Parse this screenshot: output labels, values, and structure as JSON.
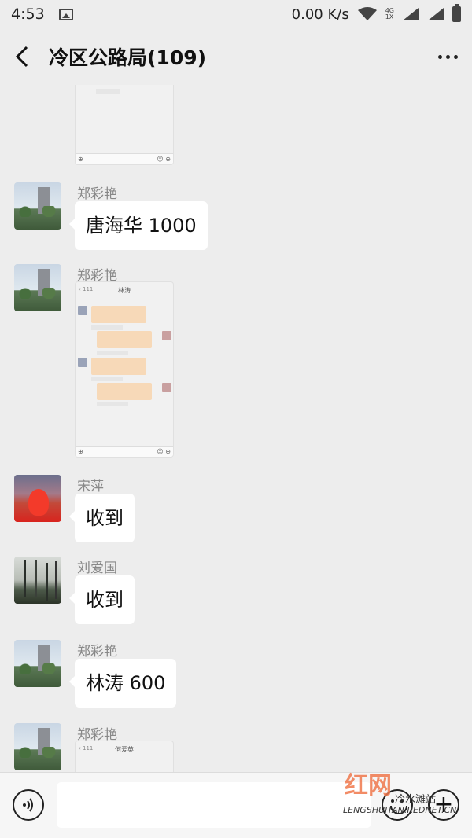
{
  "status_bar": {
    "time": "4:53",
    "network_speed": "0.00 K/s",
    "net_label_top": "4G",
    "net_label_bottom": "1X"
  },
  "header": {
    "title": "冷区公路局(109)"
  },
  "messages": [
    {
      "sender": "郑彩艳",
      "text": "唐海华 1000",
      "avatar": "building-avatar"
    },
    {
      "sender": "郑彩艳",
      "image": "chat-screenshot",
      "shot_title": "林涛",
      "avatar": "building-avatar"
    },
    {
      "sender": "宋萍",
      "text": "收到",
      "avatar": "red-dress-avatar"
    },
    {
      "sender": "刘爱国",
      "text": "收到",
      "avatar": "forest-avatar"
    },
    {
      "sender": "郑彩艳",
      "text": "林涛 600",
      "avatar": "building-avatar"
    },
    {
      "sender": "郑彩艳",
      "image": "chat-screenshot",
      "shot_title": "何爱英",
      "avatar": "building-avatar"
    }
  ],
  "input_bar": {
    "voice_icon": "voice-icon",
    "emoji_icon": "emoji-icon",
    "plus_icon": "plus-icon"
  },
  "watermark": {
    "logo": "红网",
    "text": "LENGSHUITAN.REDNET.CN",
    "station": "冷水滩站"
  }
}
